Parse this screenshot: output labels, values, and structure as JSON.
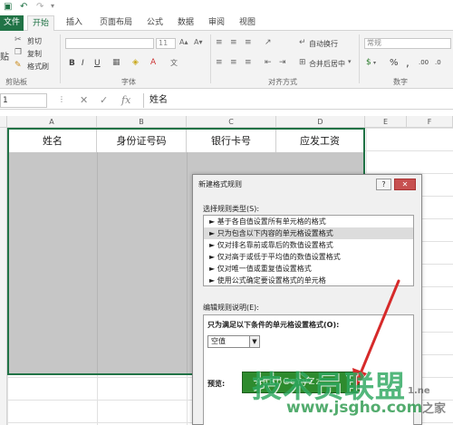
{
  "qat": {
    "save_icon": "save-icon",
    "undo_icon": "undo-icon",
    "redo_icon": "redo-icon"
  },
  "tabs": {
    "file": "文件",
    "home": "开始",
    "insert": "插入",
    "layout": "页面布局",
    "formulas": "公式",
    "data": "数据",
    "review": "审阅",
    "view": "视图"
  },
  "ribbon": {
    "cut": "剪切",
    "copy": "复制",
    "format_painter": "格式刷",
    "paste": "贴",
    "clipboard_label": "剪贴板",
    "font_size": "11",
    "font_label": "字体",
    "wrap_text": "自动换行",
    "merge_center": "合并后居中",
    "alignment_label": "对齐方式",
    "number_format": "常规",
    "number_label": "数字",
    "percent": "%",
    "comma": ",",
    "bold": "B",
    "italic": "I",
    "underline": "U",
    "increase_decimal": ".00",
    "decrease_decimal": ".0"
  },
  "formula_bar": {
    "name_box": "1",
    "cancel": "✕",
    "enter": "✓",
    "fx": "fx",
    "content": "姓名"
  },
  "columns": [
    "A",
    "B",
    "C",
    "D",
    "E",
    "F"
  ],
  "headers": [
    "姓名",
    "身份证号码",
    "银行卡号",
    "应发工资"
  ],
  "dialog": {
    "title": "新建格式规则",
    "help": "?",
    "close": "✕",
    "select_rule_type": "选择规则类型(S):",
    "rules": [
      "► 基于各自值设置所有单元格的格式",
      "► 只为包含以下内容的单元格设置格式",
      "► 仅对排名靠前或靠后的数值设置格式",
      "► 仅对高于或低于平均值的数值设置格式",
      "► 仅对唯一值或重复值设置格式",
      "► 使用公式确定要设置格式的单元格"
    ],
    "selected_rule": 1,
    "edit_description": "编辑规则说明(E):",
    "format_only": "只为满足以下条件的单元格设置格式(O):",
    "condition": "空值",
    "preview_label": "预览:",
    "preview_text": "AaBbCcYyZz"
  },
  "watermark": {
    "big": "技术员联盟",
    "url": "www.jsgho.com",
    "small1": "1.ne",
    "small2": "之家"
  },
  "colors": {
    "excel_green": "#217346",
    "selection_gray": "#c6c6c6",
    "preview_green": "#2e8b2e",
    "arrow_red": "#d62a2a"
  }
}
